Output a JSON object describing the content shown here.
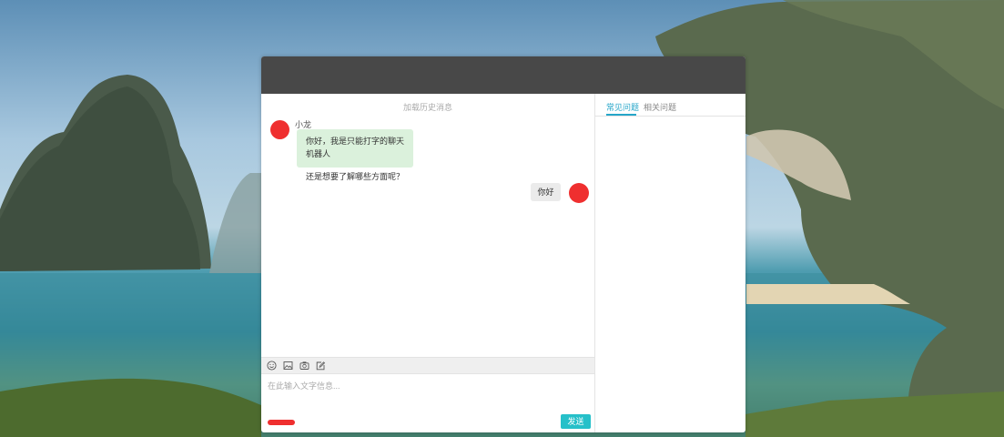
{
  "chat": {
    "history_link": "加载历史消息",
    "incoming": {
      "sender": "小龙",
      "line1": "你好，我是只能打字的聊天机器人",
      "line2": "还是想要了解哪些方面呢？"
    },
    "outgoing": {
      "text": "你好"
    },
    "toolbar": {
      "icons": [
        "smiley-icon",
        "image-icon",
        "camera-icon",
        "edit-icon"
      ]
    },
    "input": {
      "placeholder": "在此输入文字信息...",
      "value": ""
    },
    "send_label": "发送"
  },
  "side": {
    "tabs": [
      {
        "label": "常见问题",
        "active": true
      },
      {
        "label": "相关问题",
        "active": false
      }
    ]
  },
  "colors": {
    "title_bar": "#484848",
    "accent": "#26c0c9",
    "tab_active": "#26a6c9",
    "incoming_bubble": "#dbf1dc",
    "outgoing_bubble": "#ebebeb",
    "avatar_redaction": "#ef2f2f"
  }
}
